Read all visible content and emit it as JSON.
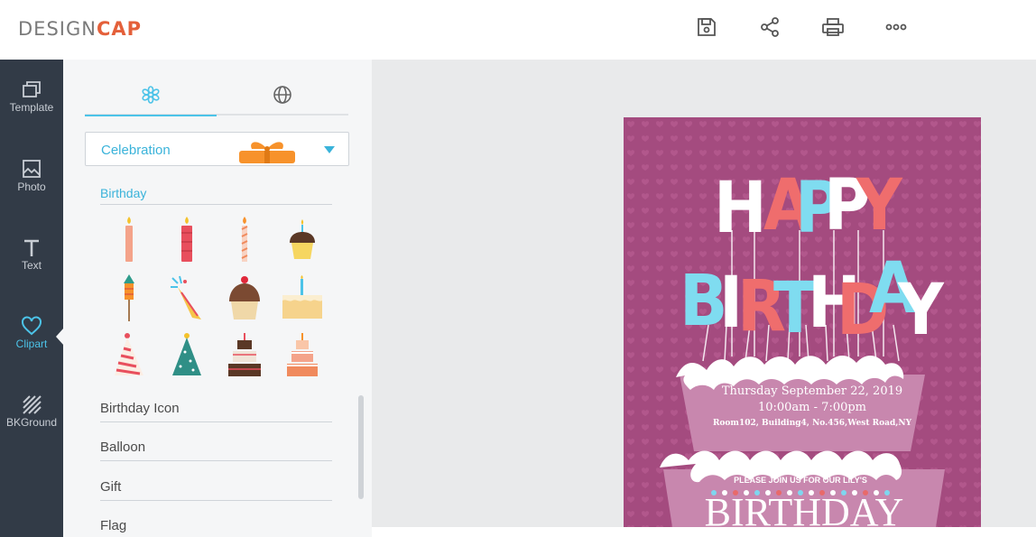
{
  "app": {
    "logo_part1": "DESIGN",
    "logo_part2": "CAP",
    "accent": "#4cc3e8",
    "brand": "#e4603a"
  },
  "toolbar": {
    "buttons": [
      {
        "icon": "save-icon"
      },
      {
        "icon": "share-icon"
      },
      {
        "icon": "print-icon"
      },
      {
        "icon": "more-icon"
      }
    ]
  },
  "leftnav": {
    "items": [
      {
        "label": "Template",
        "icon": "template-icon"
      },
      {
        "label": "Photo",
        "icon": "photo-icon"
      },
      {
        "label": "Text",
        "icon": "text-icon"
      },
      {
        "label": "Clipart",
        "icon": "heart-icon",
        "active": true
      },
      {
        "label": "BKGround",
        "icon": "background-icon"
      }
    ]
  },
  "panel": {
    "tabs": [
      {
        "icon": "flower-icon",
        "active": true
      },
      {
        "icon": "globe-icon"
      }
    ],
    "category_select": {
      "value": "Celebration"
    },
    "section_title": "Birthday",
    "cliparts": [
      "candle-pink",
      "candle-red",
      "candle-striped",
      "cupcake-yellow",
      "rocket-firework",
      "party-popper",
      "cupcake-chocolate",
      "cake-slice",
      "party-hat-striped",
      "party-hat-stars",
      "tiered-cake-dark",
      "tiered-cake-light"
    ],
    "categories": [
      "Birthday Icon",
      "Balloon",
      "Gift",
      "Flag"
    ]
  },
  "card": {
    "line1": [
      "H",
      "A",
      "P",
      "P",
      "Y"
    ],
    "line2": [
      "B",
      "I",
      "R",
      "T",
      "H",
      "D",
      "A",
      "Y"
    ],
    "date": "Thursday  September 22, 2019",
    "time": "10:00am - 7:00pm",
    "address": "Room102, Building4, No.456,West Road,NY",
    "invite": "PLEASE JOIN US FOR  OUR LILY'S",
    "big_word": "BIRTHDAY",
    "bg_color": "#a44b7f"
  }
}
